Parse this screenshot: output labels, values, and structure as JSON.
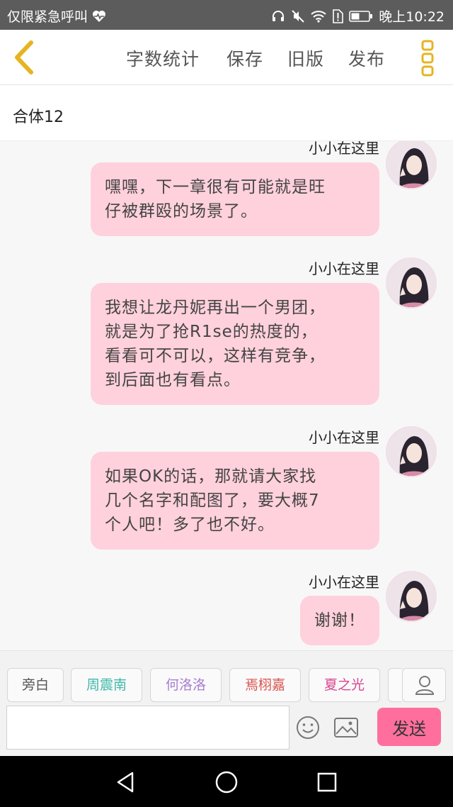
{
  "status_bar": {
    "carrier": "仅限紧急呼叫",
    "time": "晚上10:22"
  },
  "toolbar": {
    "items": [
      "字数统计",
      "保存",
      "旧版",
      "发布"
    ],
    "accent_color": "#e6b422"
  },
  "chapter": {
    "title": "合体12"
  },
  "messages": [
    {
      "sender": "小小在这里",
      "lines": [
        "嘿嘿，下一章很有可能就是旺",
        "仔被群殴的场景了。"
      ]
    },
    {
      "sender": "小小在这里",
      "lines": [
        "我想让龙丹妮再出一个男团，",
        "就是为了抢R1se的热度的，",
        "看看可不可以，这样有竞争，",
        "到后面也有看点。"
      ]
    },
    {
      "sender": "小小在这里",
      "lines": [
        "如果OK的话，那就请大家找",
        "几个名字和配图了，要大概7",
        "个人吧！多了也不好。"
      ]
    },
    {
      "sender": "小小在这里",
      "lines": [
        "谢谢！"
      ]
    }
  ],
  "roles": [
    {
      "label": "旁白",
      "color": "#555555"
    },
    {
      "label": "周震南",
      "color": "#3fb8a8"
    },
    {
      "label": "何洛洛",
      "color": "#a77fd0"
    },
    {
      "label": "焉栩嘉",
      "color": "#d9534f"
    },
    {
      "label": "夏之光",
      "color": "#d9468f"
    }
  ],
  "composer": {
    "placeholder": "",
    "send_label": "发送",
    "send_color": "#ff6f9e"
  },
  "bubble_color": "#ffd1dc"
}
